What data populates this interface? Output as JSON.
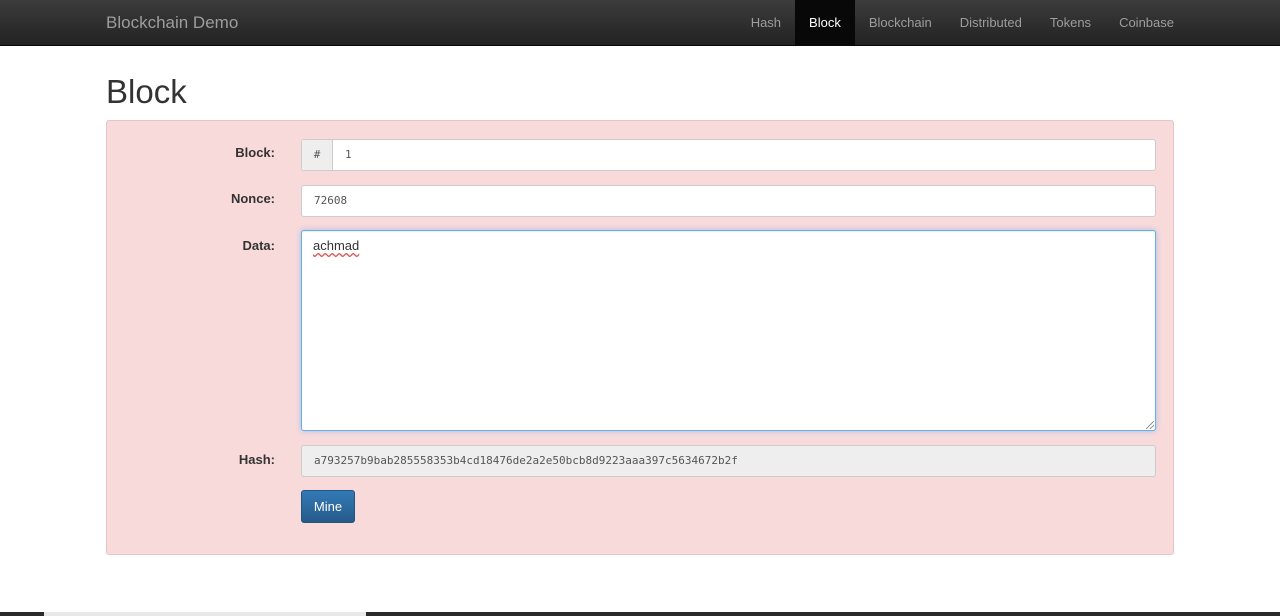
{
  "navbar": {
    "brand": "Blockchain Demo",
    "items": [
      {
        "label": "Hash",
        "active": false
      },
      {
        "label": "Block",
        "active": true
      },
      {
        "label": "Blockchain",
        "active": false
      },
      {
        "label": "Distributed",
        "active": false
      },
      {
        "label": "Tokens",
        "active": false
      },
      {
        "label": "Coinbase",
        "active": false
      }
    ]
  },
  "page": {
    "title": "Block"
  },
  "form": {
    "block_label": "Block:",
    "block_addon": "#",
    "block_value": "1",
    "nonce_label": "Nonce:",
    "nonce_value": "72608",
    "data_label": "Data:",
    "data_value": "achmad",
    "hash_label": "Hash:",
    "hash_value": "a793257b9bab285558353b4cd18476de2a2e50bcb8d9223aaa397c5634672b2f",
    "mine_button": "Mine"
  },
  "colors": {
    "navbar_bg": "#222222",
    "well_bg": "#f8dadb",
    "button_primary": "#337ab7"
  }
}
